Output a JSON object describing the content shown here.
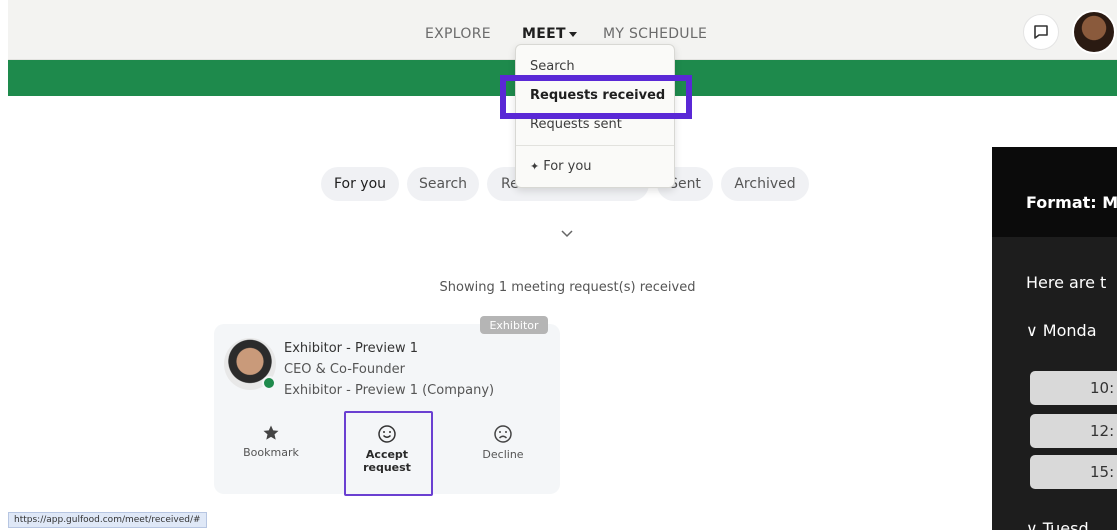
{
  "nav": {
    "explore": "EXPLORE",
    "meet": "MEET",
    "my_schedule": "MY SCHEDULE"
  },
  "dropdown": {
    "search": "Search",
    "requests_received": "Requests received",
    "requests_sent": "Requests sent",
    "for_you": "For you"
  },
  "tabs": {
    "for_you": "For you",
    "search": "Search",
    "received_partial": "Re",
    "sent": "Sent",
    "archived": "Archived"
  },
  "showing_text": "Showing 1 meeting request(s) received",
  "card": {
    "badge": "Exhibitor",
    "name": "Exhibitor - Preview 1",
    "title": "CEO & Co-Founder",
    "company": "Exhibitor - Preview 1 (Company)",
    "bookmark_label": "Bookmark",
    "accept_label_line1": "Accept",
    "accept_label_line2": "request",
    "decline_label": "Decline"
  },
  "status_url": "https://app.gulfood.com/meet/received/#",
  "panel": {
    "format": "Format: M",
    "here_are": "Here are t",
    "monday": "Monda",
    "slots": [
      "10:",
      "12:",
      "15:"
    ],
    "tuesday": "Tuesd"
  },
  "colors": {
    "brand_green": "#1e8a4c",
    "highlight_purple": "#5a28d6"
  },
  "icons": {
    "chat": "chat-bubble-icon",
    "bookmark": "star-icon",
    "accept": "smile-icon",
    "decline": "frown-icon",
    "sparkle": "sparkle-icon",
    "chevron": "chevron-down-icon"
  }
}
